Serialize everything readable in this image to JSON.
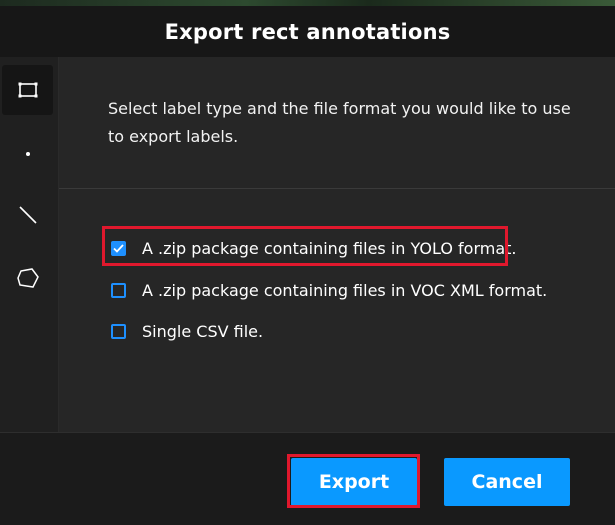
{
  "dialog": {
    "title": "Export rect annotations",
    "description": "Select label type and the file format you would like to use to export labels."
  },
  "sidebar": {
    "tools": [
      {
        "name": "rect",
        "icon": "rectangle-icon",
        "active": true
      },
      {
        "name": "point",
        "icon": "point-icon",
        "active": false
      },
      {
        "name": "line",
        "icon": "line-icon",
        "active": false
      },
      {
        "name": "polygon",
        "icon": "polygon-icon",
        "active": false
      }
    ]
  },
  "options": [
    {
      "label": "A .zip package containing files in YOLO format.",
      "checked": true
    },
    {
      "label": "A .zip package containing files in VOC XML format.",
      "checked": false
    },
    {
      "label": "Single CSV file.",
      "checked": false
    }
  ],
  "footer": {
    "export_label": "Export",
    "cancel_label": "Cancel"
  },
  "colors": {
    "accent": "#0a99ff",
    "highlight": "#e0182d"
  }
}
